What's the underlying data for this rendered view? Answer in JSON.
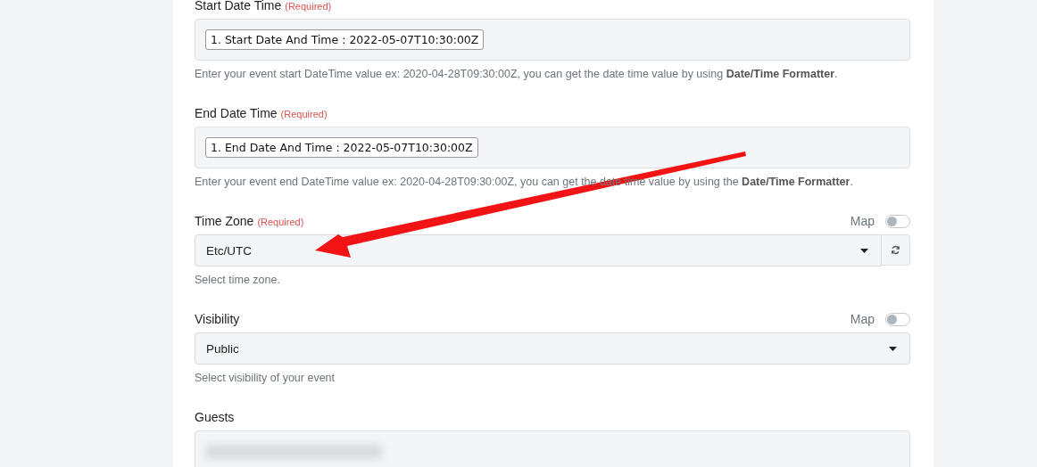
{
  "fields": [
    {
      "kind": "pills",
      "label": "Start Date Time",
      "required_note": "(Required)",
      "pills": [
        "1. Start Date And Time : 2022-05-07T10:30:00Z"
      ],
      "help": "Enter your event start DateTime value ex: 2020-04-28T09:30:00Z, you can get the date time value by using **Date/Time Formatter**."
    },
    {
      "kind": "pills",
      "label": "End Date Time",
      "required_note": "(Required)",
      "pills": [
        "1. End Date And Time : 2022-05-07T10:30:00Z"
      ],
      "help": "Enter your event end DateTime value ex: 2020-04-28T09:30:00Z, you can get the date time value by using the **Date/Time Formatter**."
    },
    {
      "kind": "select",
      "label": "Time Zone",
      "required_note": "(Required)",
      "map": {
        "label": "Map",
        "on": false
      },
      "value": "Etc/UTC",
      "refresh": true,
      "help": "Select time zone."
    },
    {
      "kind": "select",
      "label": "Visibility",
      "map": {
        "label": "Map",
        "on": false
      },
      "value": "Public",
      "refresh": false,
      "help": "Select visibility of your event"
    },
    {
      "kind": "pills",
      "label": "Guests",
      "blurred": true
    }
  ]
}
